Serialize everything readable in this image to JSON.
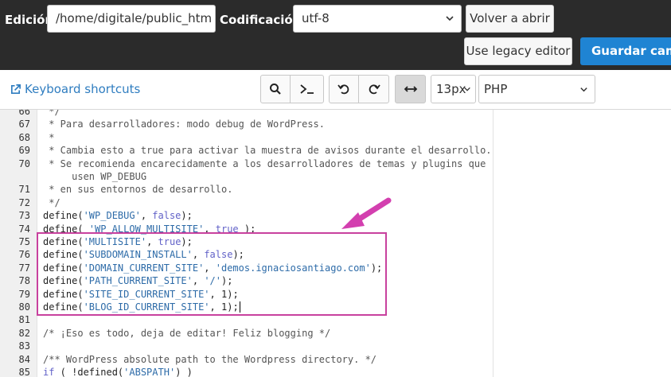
{
  "header": {
    "edition_label": "Edición:",
    "path_value": "/home/digitale/public_htm",
    "encoding_label": "Codificación:",
    "encoding_value": "utf-8",
    "reopen_label": "Volver a abrir",
    "legacy_label": "Use legacy editor",
    "save_label": "Guardar cambios"
  },
  "toolbar": {
    "keyboard_shortcuts": "Keyboard shortcuts",
    "font_size": "13px",
    "language": "PHP",
    "icons": [
      "search-icon",
      "terminal-icon",
      "undo-icon",
      "redo-icon",
      "wrap-icon"
    ]
  },
  "colors": {
    "topbar": "#2b2b2b",
    "primary_button": "#1f84d3",
    "link": "#2f7dc0",
    "highlight": "#c8419e",
    "string": "#2d6ba8",
    "boolean": "#6262c8"
  },
  "editor": {
    "lines": [
      {
        "n": "66",
        "parts": [
          {
            "t": " */",
            "c": "comment"
          }
        ]
      },
      {
        "n": "67",
        "parts": [
          {
            "t": " * Para desarrolladores: modo debug de WordPress.",
            "c": "comment"
          }
        ]
      },
      {
        "n": "68",
        "parts": [
          {
            "t": " *",
            "c": "comment"
          }
        ]
      },
      {
        "n": "69",
        "parts": [
          {
            "t": " * Cambia esto a true para activar la muestra de avisos durante el desarrollo.",
            "c": "comment"
          }
        ]
      },
      {
        "n": "70",
        "parts": [
          {
            "t": " * Se recomienda encarecidamente a los desarrolladores de temas y plugins que",
            "c": "comment"
          }
        ]
      },
      {
        "n": "",
        "parts": [
          {
            "t": "     usen WP_DEBUG",
            "c": "comment"
          }
        ]
      },
      {
        "n": "71",
        "parts": [
          {
            "t": " * en sus entornos de desarrollo.",
            "c": "comment"
          }
        ]
      },
      {
        "n": "72",
        "parts": [
          {
            "t": " */",
            "c": "comment"
          }
        ]
      },
      {
        "n": "73",
        "parts": [
          {
            "t": "define(",
            "c": "plain"
          },
          {
            "t": "'WP_DEBUG'",
            "c": "str"
          },
          {
            "t": ", ",
            "c": "plain"
          },
          {
            "t": "false",
            "c": "bool"
          },
          {
            "t": ");",
            "c": "plain"
          }
        ]
      },
      {
        "n": "74",
        "parts": [
          {
            "t": "define( ",
            "c": "plain"
          },
          {
            "t": "'WP_ALLOW_MULTISITE'",
            "c": "str"
          },
          {
            "t": ", ",
            "c": "plain"
          },
          {
            "t": "true",
            "c": "bool"
          },
          {
            "t": " );",
            "c": "plain"
          }
        ]
      },
      {
        "n": "75",
        "parts": [
          {
            "t": "define(",
            "c": "plain"
          },
          {
            "t": "'MULTISITE'",
            "c": "str"
          },
          {
            "t": ", ",
            "c": "plain"
          },
          {
            "t": "true",
            "c": "bool"
          },
          {
            "t": ");",
            "c": "plain"
          }
        ]
      },
      {
        "n": "76",
        "parts": [
          {
            "t": "define(",
            "c": "plain"
          },
          {
            "t": "'SUBDOMAIN_INSTALL'",
            "c": "str"
          },
          {
            "t": ", ",
            "c": "plain"
          },
          {
            "t": "false",
            "c": "bool"
          },
          {
            "t": ");",
            "c": "plain"
          }
        ]
      },
      {
        "n": "77",
        "parts": [
          {
            "t": "define(",
            "c": "plain"
          },
          {
            "t": "'DOMAIN_CURRENT_SITE'",
            "c": "str"
          },
          {
            "t": ", ",
            "c": "plain"
          },
          {
            "t": "'demos.ignaciosantiago.com'",
            "c": "str"
          },
          {
            "t": ");",
            "c": "plain"
          }
        ]
      },
      {
        "n": "78",
        "parts": [
          {
            "t": "define(",
            "c": "plain"
          },
          {
            "t": "'PATH_CURRENT_SITE'",
            "c": "str"
          },
          {
            "t": ", ",
            "c": "plain"
          },
          {
            "t": "'/'",
            "c": "str"
          },
          {
            "t": ");",
            "c": "plain"
          }
        ]
      },
      {
        "n": "79",
        "parts": [
          {
            "t": "define(",
            "c": "plain"
          },
          {
            "t": "'SITE_ID_CURRENT_SITE'",
            "c": "str"
          },
          {
            "t": ", ",
            "c": "plain"
          },
          {
            "t": "1",
            "c": "num"
          },
          {
            "t": ");",
            "c": "plain"
          }
        ]
      },
      {
        "n": "80",
        "parts": [
          {
            "t": "define(",
            "c": "plain"
          },
          {
            "t": "'BLOG_ID_CURRENT_SITE'",
            "c": "str"
          },
          {
            "t": ", ",
            "c": "plain"
          },
          {
            "t": "1",
            "c": "num"
          },
          {
            "t": ");",
            "c": "plain"
          }
        ]
      },
      {
        "n": "81",
        "parts": [
          {
            "t": "",
            "c": "plain"
          }
        ]
      },
      {
        "n": "82",
        "parts": [
          {
            "t": "/* ¡Eso es todo, deja de editar! Feliz blogging */",
            "c": "comment"
          }
        ]
      },
      {
        "n": "83",
        "parts": [
          {
            "t": "",
            "c": "plain"
          }
        ]
      },
      {
        "n": "84",
        "parts": [
          {
            "t": "/** WordPress absolute path to the Wordpress directory. */",
            "c": "comment"
          }
        ]
      },
      {
        "n": "85",
        "parts": [
          {
            "t": "if",
            "c": "bool"
          },
          {
            "t": " ( !defined(",
            "c": "plain"
          },
          {
            "t": "'ABSPATH'",
            "c": "str"
          },
          {
            "t": ") )",
            "c": "plain"
          }
        ]
      }
    ]
  }
}
